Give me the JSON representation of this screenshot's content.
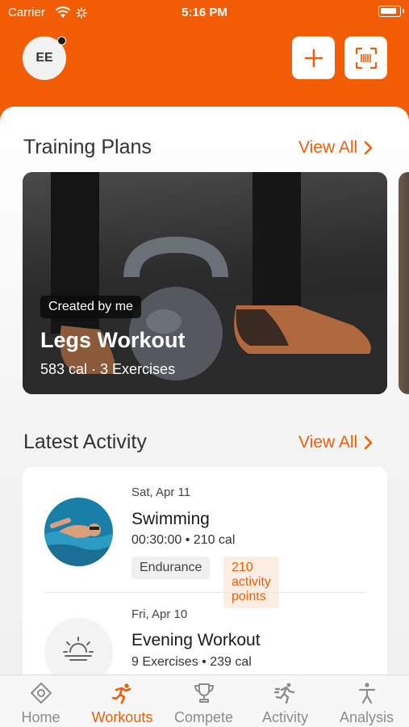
{
  "status_bar": {
    "carrier": "Carrier",
    "time": "5:16 PM"
  },
  "header": {
    "avatar_initials": "EE",
    "add_icon": "plus-icon",
    "scan_icon": "barcode-scan-icon"
  },
  "training_plans": {
    "title": "Training Plans",
    "view_all": "View All",
    "card": {
      "tag": "Created by me",
      "title": "Legs Workout",
      "meta": "583 cal · 3 Exercises"
    }
  },
  "latest_activity": {
    "title": "Latest Activity",
    "view_all": "View All",
    "items": [
      {
        "date": "Sat, Apr 11",
        "title": "Swimming",
        "meta": "00:30:00 • 210 cal",
        "chips": [
          "Endurance",
          "210 activity points"
        ]
      },
      {
        "date": "Fri, Apr 10",
        "title": "Evening Workout",
        "meta": "9 Exercises • 239 cal"
      }
    ]
  },
  "tabs": [
    {
      "label": "Home",
      "icon": "home-icon",
      "active": false
    },
    {
      "label": "Workouts",
      "icon": "workouts-icon",
      "active": true
    },
    {
      "label": "Compete",
      "icon": "trophy-icon",
      "active": false
    },
    {
      "label": "Activity",
      "icon": "running-icon",
      "active": false
    },
    {
      "label": "Analysis",
      "icon": "person-icon",
      "active": false
    }
  ],
  "colors": {
    "accent": "#f25c05",
    "tab_inactive": "#8c8c8c"
  }
}
